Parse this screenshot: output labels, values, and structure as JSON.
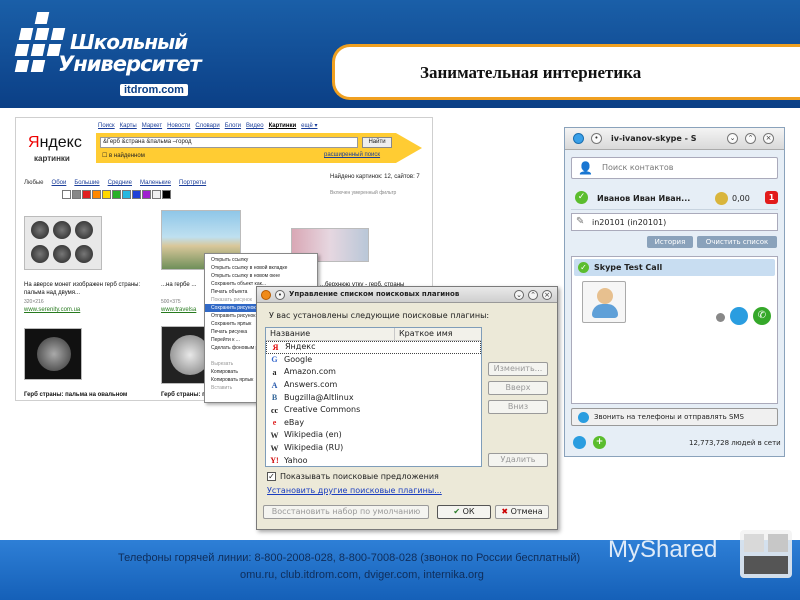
{
  "slide": {
    "logo_line1": "Школьный",
    "logo_line2": "Университет",
    "logo_site": "itdrom.com",
    "title": "Занимательная интернетика",
    "footer_line1": "Телефоны горячей линии: 8-800-2008-028, 8-800-7008-028 (звонок по России бесплатный)",
    "footer_line2": "omu.ru,   club.itdrom.com,   dviger.com,   internika.org",
    "watermark": "MyShared"
  },
  "yandex": {
    "logo_first": "Я",
    "logo_rest": "ндекс",
    "section": "картинки",
    "nav": [
      "Поиск",
      "Карты",
      "Маркет",
      "Новости",
      "Словари",
      "Блоги",
      "Видео",
      "Картинки",
      "ещё ▾"
    ],
    "nav_active_index": 7,
    "search_value": "&Герб &страна &пальма –город",
    "search_button": "Найти",
    "found_checkbox": "в найденном",
    "advanced": "расширенный поиск",
    "filter_label": "Любые",
    "filters": [
      "Обои",
      "Большие",
      "Средние",
      "Маленькие",
      "Портреты"
    ],
    "colors": [
      "#ffffff",
      "#888888",
      "#e02020",
      "#ff8800",
      "#ffd800",
      "#28b028",
      "#26b8e0",
      "#2040d8",
      "#a020d0",
      "#f0f0f0",
      "#000000"
    ],
    "count_text": "Найдено картинок: 12, сайтов: 7",
    "count_sub": "Включен умеренный фильтр",
    "results": [
      {
        "caption": "На аверсе монет изображен герб страны: пальма над двумя...",
        "meta": "320×216",
        "link": "www.serenity.com.ua"
      },
      {
        "caption": "...на гербе ...",
        "meta": "500×375",
        "link": "www.travelsa"
      },
      {
        "caption": "...берхнюю утку - герб. страны ...пальма",
        "meta": "",
        "link": ""
      },
      {
        "caption": "Герб страны: пальма на овальном",
        "meta": "",
        "link": ""
      },
      {
        "caption": "Герб страны: п...",
        "meta": "",
        "link": ""
      }
    ],
    "context_menu": [
      {
        "label": "Открыть ссылку",
        "state": "normal"
      },
      {
        "label": "Открыть ссылку в новой вкладке",
        "state": "normal"
      },
      {
        "label": "Открыть ссылку в новом окне",
        "state": "normal"
      },
      {
        "label": "Сохранить объект как...",
        "state": "normal"
      },
      {
        "label": "Печать объекта",
        "state": "normal"
      },
      {
        "label": "Показать рисунок",
        "state": "dim"
      },
      {
        "label": "Сохранить рисунок как...",
        "state": "selected"
      },
      {
        "label": "Отправить рисунок...",
        "state": "normal"
      },
      {
        "label": "Сохранить ярлык",
        "state": "normal"
      },
      {
        "label": "Печать рисунка",
        "state": "normal"
      },
      {
        "label": "Перейти к ...",
        "state": "normal"
      },
      {
        "label": "Сделать фоновым рисунком",
        "state": "normal"
      },
      {
        "label": "",
        "state": "normal"
      },
      {
        "label": "Вырезать",
        "state": "dim"
      },
      {
        "label": "Копировать",
        "state": "normal"
      },
      {
        "label": "Копировать ярлык",
        "state": "normal"
      },
      {
        "label": "Вставить",
        "state": "dim"
      }
    ]
  },
  "dialog": {
    "title": "Управление списком поисковых плагинов",
    "installed_label": "У вас установлены следующие поисковые плагины:",
    "col_name": "Название",
    "col_short": "Краткое имя",
    "engines": [
      {
        "name": "Яндекс",
        "icon": "Я",
        "color": "#e00000"
      },
      {
        "name": "Google",
        "icon": "G",
        "color": "#3366cc"
      },
      {
        "name": "Amazon.com",
        "icon": "a",
        "color": "#222222"
      },
      {
        "name": "Answers.com",
        "icon": "A",
        "color": "#2255aa"
      },
      {
        "name": "Bugzilla@Altlinux",
        "icon": "B",
        "color": "#336699"
      },
      {
        "name": "Creative Commons",
        "icon": "cc",
        "color": "#111111"
      },
      {
        "name": "eBay",
        "icon": "e",
        "color": "#dd2222"
      },
      {
        "name": "Wikipedia (en)",
        "icon": "W",
        "color": "#333333"
      },
      {
        "name": "Wikipedia (RU)",
        "icon": "W",
        "color": "#333333"
      },
      {
        "name": "Yahoo",
        "icon": "Y!",
        "color": "#cc0000"
      }
    ],
    "btn_edit": "Изменить...",
    "btn_up": "Вверх",
    "btn_down": "Вниз",
    "btn_remove": "Удалить",
    "suggest_label": "Показывать поисковые предложения",
    "suggest_checked": "✓",
    "more_link": "Установить другие поисковые плагины...",
    "restore_button": "Восстановить набор по умолчанию",
    "ok_button": "ОК",
    "cancel_button": "Отмена"
  },
  "skype": {
    "title": "iv-ivanov-skype - S",
    "search_placeholder": "Поиск контактов",
    "user_name": "Иванов Иван Иван...",
    "balance": "0,00",
    "alerts": "1",
    "mood": "in20101 (in20101)",
    "tab_history": "История",
    "tab_clear": "Очистить список",
    "contact": "Skype Test Call",
    "call_phones": "Звонить на телефоны и отправлять SMS",
    "online_count": "12,773,728 людей в сети"
  }
}
